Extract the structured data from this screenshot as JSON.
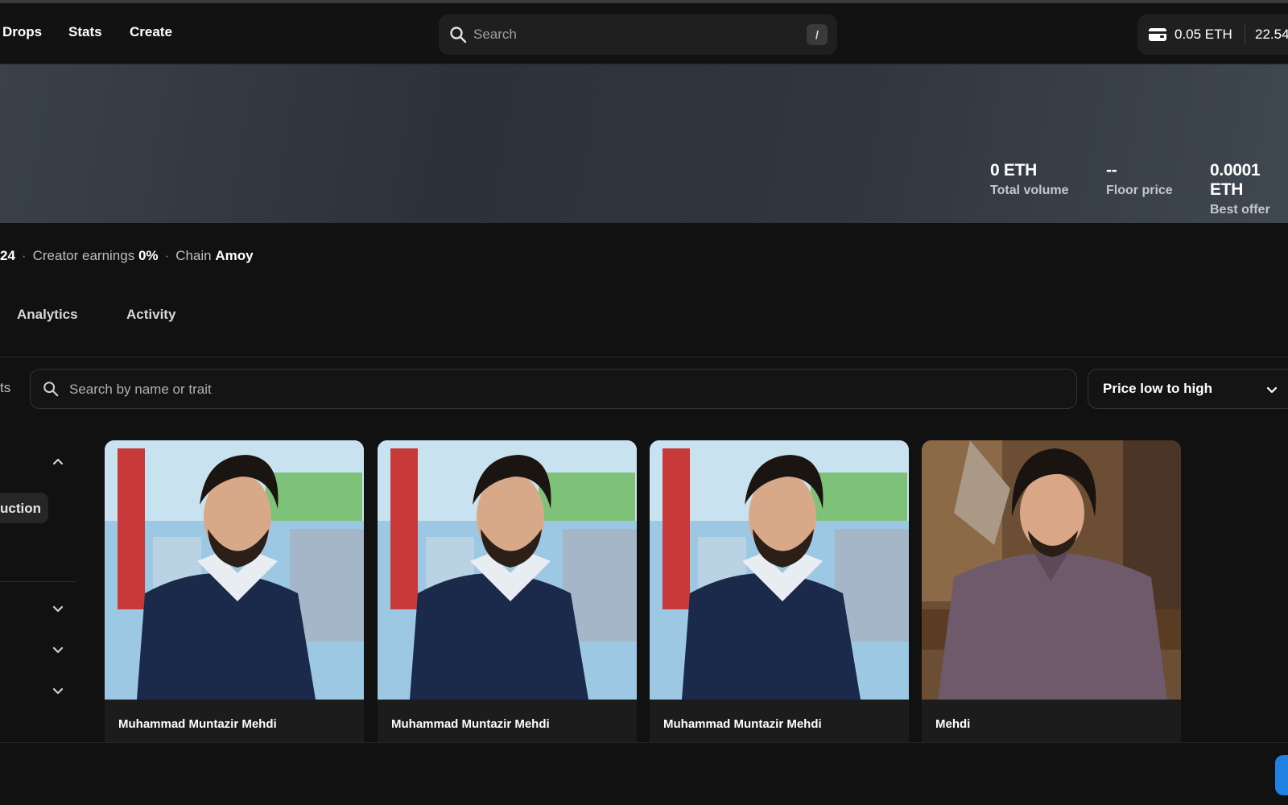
{
  "header": {
    "nav": [
      "Drops",
      "Stats",
      "Create"
    ],
    "search": {
      "placeholder": "Search",
      "shortcut": "/"
    },
    "wallet": {
      "eth": "0.05 ETH",
      "usd": "22.54"
    }
  },
  "stats": [
    {
      "value": "0 ETH",
      "label": "Total volume"
    },
    {
      "value": "--",
      "label": "Floor price"
    },
    {
      "value": "0.0001 ETH",
      "label": "Best offer"
    }
  ],
  "meta": {
    "date_tail": "24",
    "earnings_label": "Creator earnings",
    "earnings_value": "0%",
    "chain_label": "Chain",
    "chain_value": "Amoy"
  },
  "tabs": [
    "Analytics",
    "Activity"
  ],
  "filter": {
    "left_label_tail": "ts",
    "search_placeholder": "Search by name or trait",
    "sort_label": "Price low to high"
  },
  "sidebar": {
    "chip_label": "uction"
  },
  "items": [
    {
      "name": "Muhammad Muntazir Mehdi"
    },
    {
      "name": "Muhammad Muntazir Mehdi"
    },
    {
      "name": "Muhammad Muntazir Mehdi"
    },
    {
      "name": "Mehdi"
    }
  ],
  "colors": {
    "accent": "#2081e2",
    "background": "#111111"
  },
  "icons": [
    "search-icon",
    "wallet-icon",
    "chevron-up-icon",
    "chevron-down-icon"
  ]
}
